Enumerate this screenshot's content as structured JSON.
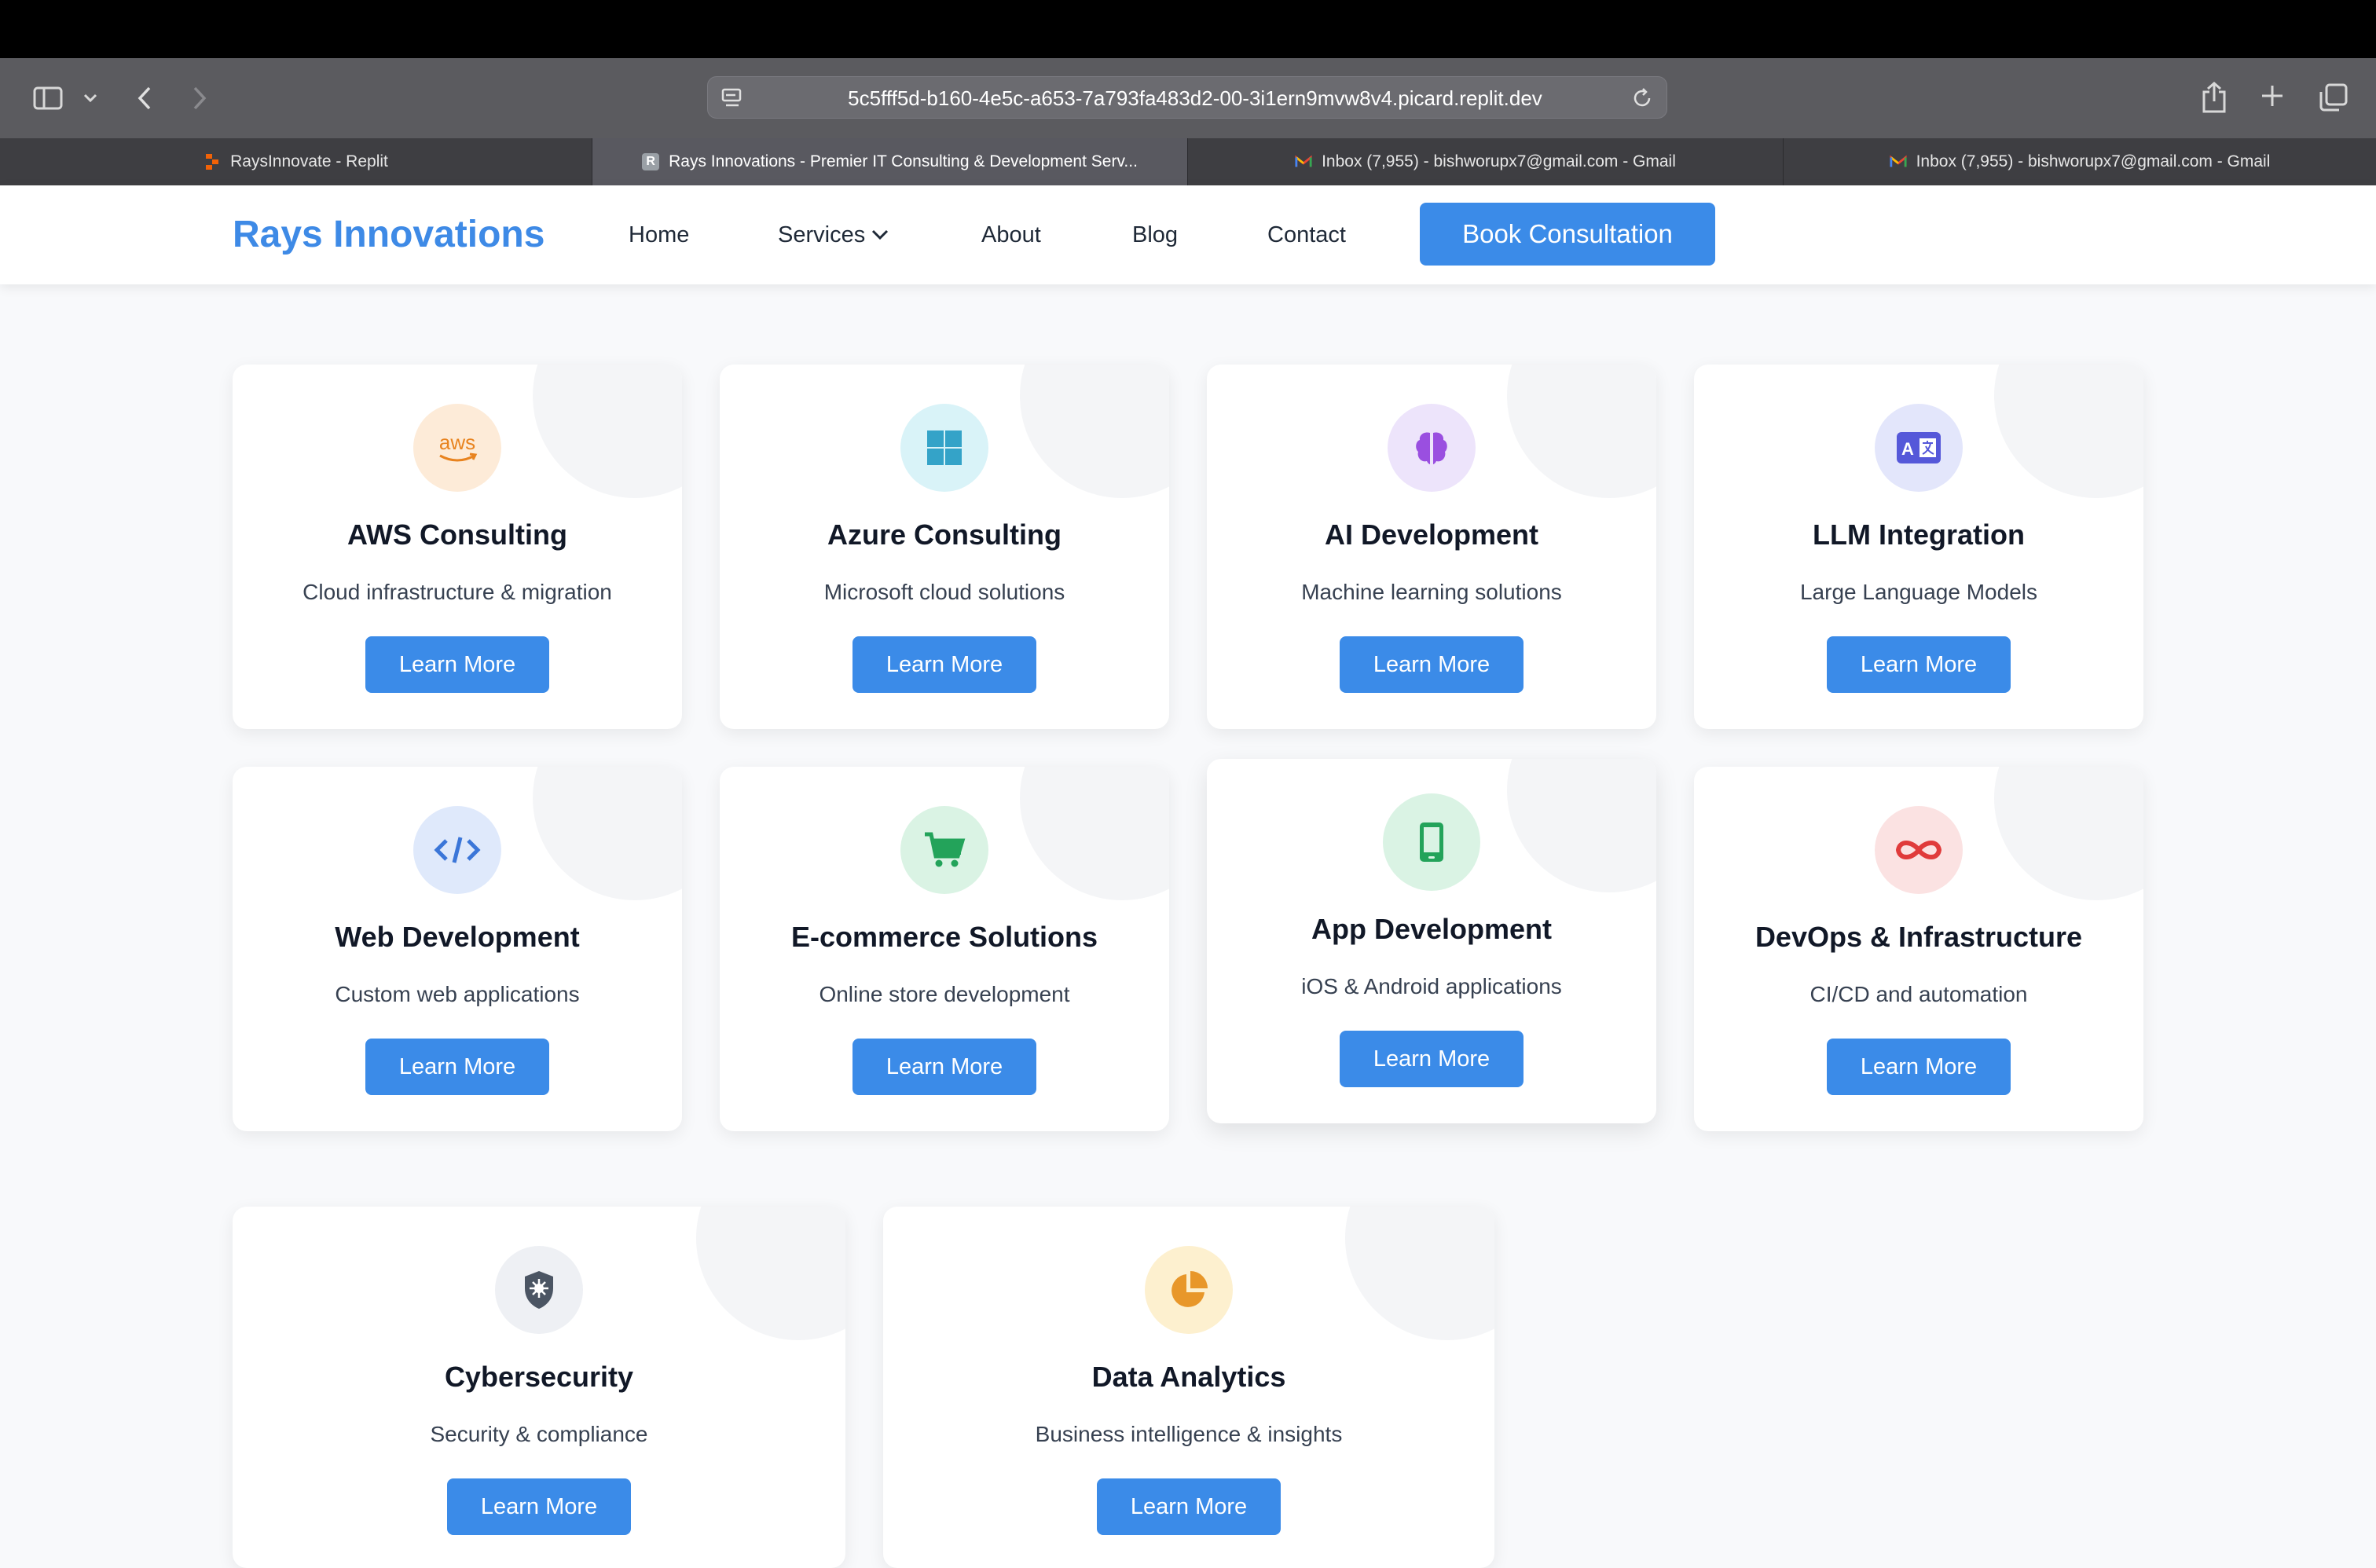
{
  "browser": {
    "url": "5c5fff5d-b160-4e5c-a653-7a793fa483d2-00-3i1ern9mvw8v4.picard.replit.dev",
    "tabs": [
      {
        "label": "RaysInnovate - Replit"
      },
      {
        "label": "Rays Innovations - Premier IT Consulting & Development Serv..."
      },
      {
        "label": "Inbox (7,955) - bishworupx7@gmail.com - Gmail"
      },
      {
        "label": "Inbox (7,955) - bishworupx7@gmail.com - Gmail"
      }
    ]
  },
  "header": {
    "brand": "Rays Innovations",
    "nav": {
      "home": "Home",
      "services": "Services",
      "about": "About",
      "blog": "Blog",
      "contact": "Contact"
    },
    "cta": "Book Consultation"
  },
  "services": [
    {
      "title": "AWS Consulting",
      "desc": "Cloud infrastructure & migration",
      "button": "Learn More",
      "icon": "aws-icon",
      "icon_text": "aws"
    },
    {
      "title": "Azure Consulting",
      "desc": "Microsoft cloud solutions",
      "button": "Learn More",
      "icon": "windows-icon"
    },
    {
      "title": "AI Development",
      "desc": "Machine learning solutions",
      "button": "Learn More",
      "icon": "brain-icon"
    },
    {
      "title": "LLM Integration",
      "desc": "Large Language Models",
      "button": "Learn More",
      "icon": "translate-icon"
    },
    {
      "title": "Web Development",
      "desc": "Custom web applications",
      "button": "Learn More",
      "icon": "code-icon",
      "icon_text": "</>"
    },
    {
      "title": "E-commerce Solutions",
      "desc": "Online store development",
      "button": "Learn More",
      "icon": "cart-icon"
    },
    {
      "title": "App Development",
      "desc": "iOS & Android applications",
      "button": "Learn More",
      "icon": "mobile-icon"
    },
    {
      "title": "DevOps & Infrastructure",
      "desc": "CI/CD and automation",
      "button": "Learn More",
      "icon": "infinity-icon",
      "icon_text": "∞"
    },
    {
      "title": "Cybersecurity",
      "desc": "Security & compliance",
      "button": "Learn More",
      "icon": "shield-icon"
    },
    {
      "title": "Data Analytics",
      "desc": "Business intelligence & insights",
      "button": "Learn More",
      "icon": "pie-chart-icon"
    }
  ],
  "colors": {
    "brand": "#3e8ae6",
    "button": "#3b8be8",
    "aws_bg": "#fdebd8",
    "azure_bg": "#d9f3f8",
    "ai_bg": "#ede4fb",
    "llm_bg": "#e3e6fb",
    "web_bg": "#dfe9fb",
    "ecom_bg": "#daf3e4",
    "app_bg": "#daf3e4",
    "devops_bg": "#fbe2e2",
    "security_bg": "#eef0f4",
    "analytics_bg": "#fdf0cf"
  }
}
